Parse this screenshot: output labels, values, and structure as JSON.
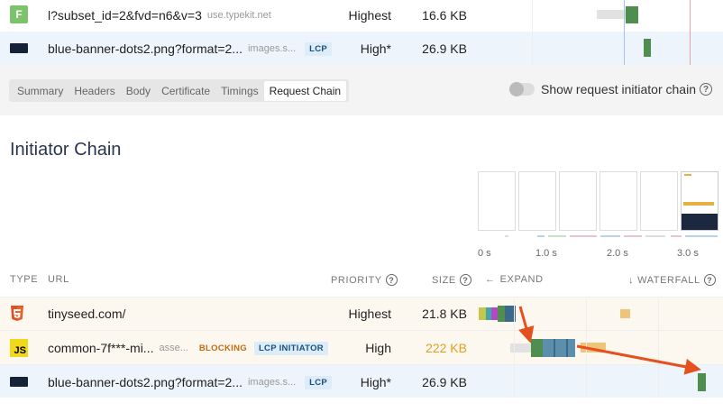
{
  "top_rows": [
    {
      "type_icon": "font-icon",
      "type_letter": "F",
      "url": "l?subset_id=2&fvd=n6&v=3",
      "host": "use.typekit.net",
      "priority": "Highest",
      "size": "16.6 KB"
    },
    {
      "type_icon": "image-icon",
      "url": "blue-banner-dots2.png?format=2...",
      "host": "images.s...",
      "badge": "LCP",
      "priority": "High*",
      "size": "26.9 KB"
    }
  ],
  "tabs": [
    "Summary",
    "Headers",
    "Body",
    "Certificate",
    "Timings",
    "Request Chain"
  ],
  "active_tab": "Request Chain",
  "toggle_label": "Show request initiator chain",
  "section_title": "Initiator Chain",
  "timeline_ticks": [
    "0 s",
    "1.0 s",
    "2.0 s",
    "3.0 s"
  ],
  "columns": {
    "type": "TYPE",
    "url": "URL",
    "priority": "PRIORITY",
    "size": "SIZE",
    "expand": "EXPAND",
    "waterfall": "WATERFALL"
  },
  "chain_rows": [
    {
      "type_icon": "html-icon",
      "url": "tinyseed.com/",
      "priority": "Highest",
      "size": "21.8 KB"
    },
    {
      "type_icon": "js-icon",
      "type_letter": "JS",
      "url": "common-7f***-mi...",
      "host": "asse...",
      "badge_blocking": "BLOCKING",
      "badge_lcp": "LCP INITIATOR",
      "priority": "High",
      "size": "222 KB",
      "size_color": "#e0a020"
    },
    {
      "type_icon": "image-icon",
      "url": "blue-banner-dots2.png?format=2...",
      "host": "images.s...",
      "badge": "LCP",
      "priority": "High*",
      "size": "26.9 KB"
    }
  ],
  "colors": {
    "highlight_row": "#eef4fb",
    "html_row": "#fdf8ef",
    "js_row": "#fdf8ef",
    "arrow": "#e5501f",
    "green": "#4f8e4f",
    "blue_dark": "#3b6a88",
    "blue_mid": "#5c8fab"
  }
}
